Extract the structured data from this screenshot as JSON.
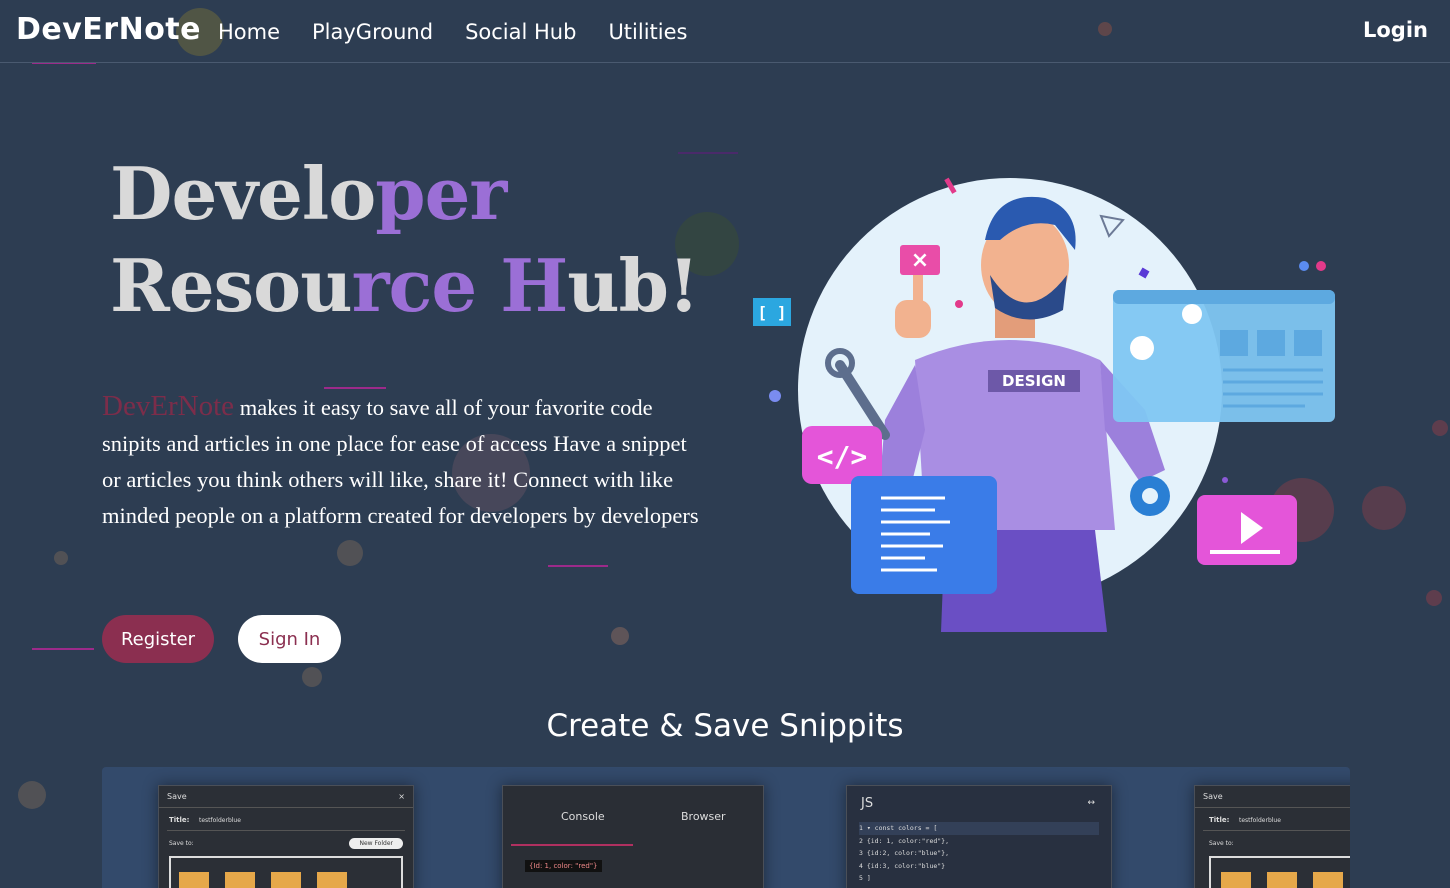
{
  "nav": {
    "brand": "DevErNote",
    "links": [
      "Home",
      "PlayGround",
      "Social Hub",
      "Utilities"
    ],
    "login": "Login"
  },
  "hero": {
    "title_line1_a": "Develo",
    "title_line1_b": "per",
    "title_line2_a": "Resou",
    "title_line2_b": "rce H",
    "title_line2_c": "ub!",
    "brand_word": "DevErNote",
    "description": " makes it easy to save all of your favorite code snipits and articles in one place for ease of access Have a snippet or articles you think others will like, share it! Connect with like minded people on a platform created for developers by developers",
    "register": "Register",
    "signin": "Sign In"
  },
  "illustration": {
    "shirt_text": "DESIGN",
    "code_badge": "</>",
    "bracket_badge": "[ ]"
  },
  "section": {
    "title": "Create & Save Snippits"
  },
  "gallery": {
    "shot1": {
      "header": "Save",
      "close": "×",
      "title_label": "Title:",
      "title_value": "testfolderblue",
      "save_to": "Save to:",
      "new_folder": "New Folder"
    },
    "shot2": {
      "tab1": "Console",
      "tab2": "Browser",
      "log": "{Id: 1, color: \"red\"}"
    },
    "shot3": {
      "lang": "JS",
      "code": [
        "1 ▾ const colors = [",
        "2     {id: 1, color:\"red\"},",
        "3     {id:2, color:\"blue\"},",
        "4     {id:3, color:\"blue\"}",
        "5 ]"
      ]
    },
    "shot4": {
      "header": "Save",
      "title_label": "Title:",
      "title_value": "testfolderblue",
      "save_to": "Save to:"
    }
  },
  "colors": {
    "background": "#2d3d52",
    "accent_purple": "#9b6fd6",
    "brand_maroon": "#8b2f50"
  }
}
